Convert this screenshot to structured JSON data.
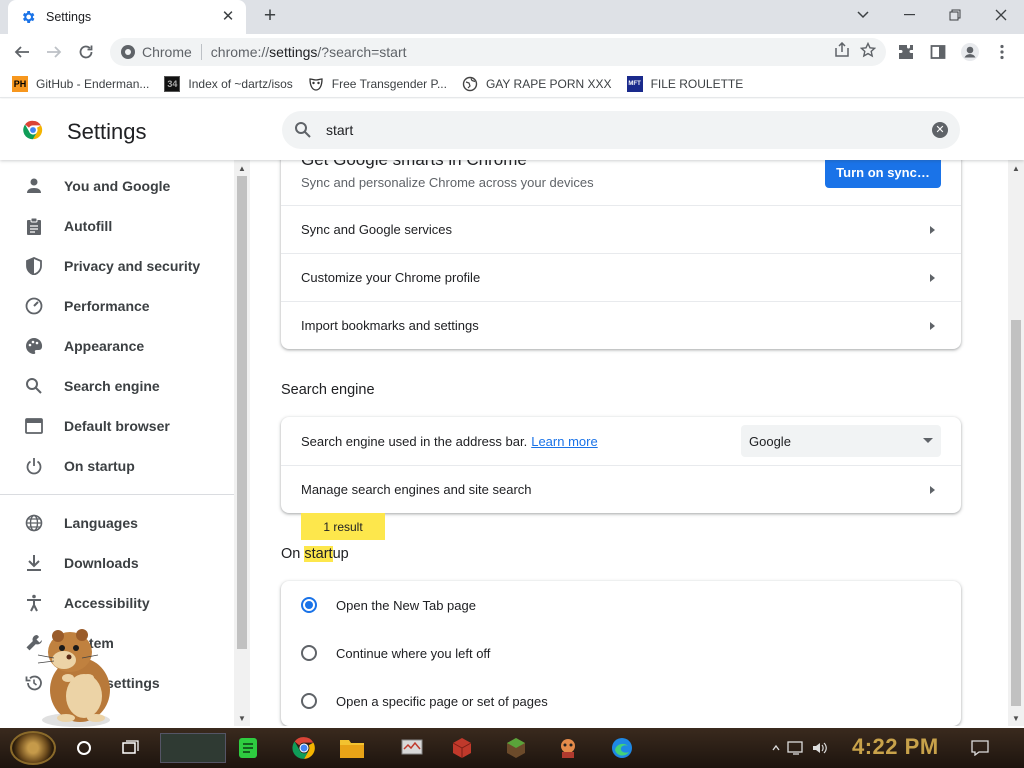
{
  "browser": {
    "tab_title": "Settings",
    "omnibox_chip": "Chrome",
    "url_prefix": "chrome://",
    "url_main": "settings",
    "url_query": "/?search=start"
  },
  "bookmarks": [
    {
      "label": "GitHub - Enderman...",
      "icon": "ph-icon"
    },
    {
      "label": "Index of ~dartz/isos",
      "icon": "34-icon"
    },
    {
      "label": "Free Transgender P...",
      "icon": "mask-icon"
    },
    {
      "label": "GAY RAPE PORN XXX",
      "icon": "globe-icon"
    },
    {
      "label": "FILE ROULETTE",
      "icon": "mft-icon"
    }
  ],
  "settings": {
    "title": "Settings",
    "search_value": "start",
    "sidebar": [
      {
        "label": "You and Google",
        "icon": "person-icon"
      },
      {
        "label": "Autofill",
        "icon": "clipboard-icon"
      },
      {
        "label": "Privacy and security",
        "icon": "shield-icon"
      },
      {
        "label": "Performance",
        "icon": "gauge-icon"
      },
      {
        "label": "Appearance",
        "icon": "palette-icon"
      },
      {
        "label": "Search engine",
        "icon": "search-icon"
      },
      {
        "label": "Default browser",
        "icon": "browser-icon"
      },
      {
        "label": "On startup",
        "icon": "power-icon"
      },
      {
        "label": "Languages",
        "icon": "globe-icon"
      },
      {
        "label": "Downloads",
        "icon": "download-icon"
      },
      {
        "label": "Accessibility",
        "icon": "accessibility-icon"
      },
      {
        "label": "System",
        "icon": "wrench-icon"
      },
      {
        "label": "Reset settings",
        "icon": "restore-icon"
      }
    ],
    "sync": {
      "title": "Get Google smarts in Chrome",
      "subtitle": "Sync and personalize Chrome across your devices",
      "button": "Turn on sync…"
    },
    "you_rows": [
      "Sync and Google services",
      "Customize your Chrome profile",
      "Import bookmarks and settings"
    ],
    "search_engine": {
      "section_title": "Search engine",
      "row1_text": "Search engine used in the address bar.",
      "learn_more": "Learn more",
      "selected": "Google",
      "row2_text": "Manage search engines and site search"
    },
    "results_bubble": "1 result",
    "startup": {
      "title_highlight": "start",
      "title_rest": "up",
      "title_prefix": "On ",
      "options": [
        "Open the New Tab page",
        "Continue where you left off",
        "Open a specific page or set of pages"
      ],
      "selected_index": 0
    }
  },
  "taskbar": {
    "clock": "4:22 PM"
  },
  "colors": {
    "accent": "#1a73e8",
    "highlight": "#fde74c",
    "taskbar": "#2a1d14",
    "clock": "#c8a24a"
  }
}
